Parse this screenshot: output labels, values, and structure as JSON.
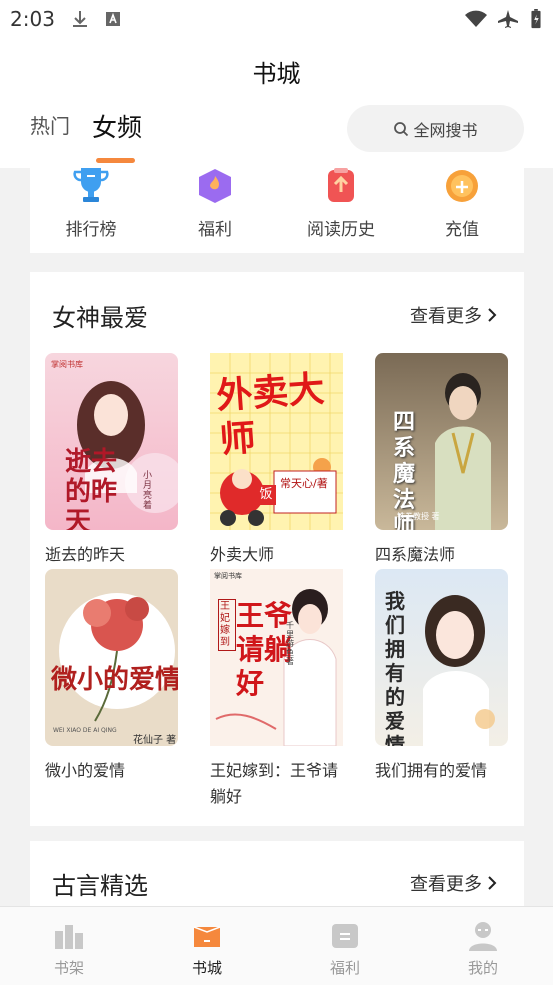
{
  "status_bar": {
    "time": "2:03"
  },
  "header": {
    "title": "书城",
    "tabs": [
      "热门",
      "女频"
    ],
    "search_label": "全网搜书"
  },
  "quick_links": [
    {
      "label": "排行榜",
      "icon": "trophy-icon"
    },
    {
      "label": "福利",
      "icon": "gift-icon"
    },
    {
      "label": "阅读历史",
      "icon": "history-icon"
    },
    {
      "label": "充值",
      "icon": "coin-icon"
    }
  ],
  "sections": [
    {
      "title": "女神最爱",
      "more": "查看更多",
      "books": [
        {
          "name": "逝去的昨天",
          "cover_title": "逝去的昨天",
          "cover_author": "小月亮着",
          "cover_badge": "掌阅书库"
        },
        {
          "name": "外卖大师",
          "cover_title": "外卖大师",
          "cover_author": "常天心/著",
          "cover_badge": "饭"
        },
        {
          "name": "四系魔法师",
          "cover_title": "四系魔法师",
          "cover_author": "铁拳教授 著"
        },
        {
          "name": "微小的爱情",
          "cover_title": "微小的爱情",
          "cover_author": "花仙子 著",
          "cover_pinyin": "WEI XIAO DE AI QING"
        },
        {
          "name": "王妃嫁到：王爷请躺好",
          "cover_title": "王爷请躺好",
          "cover_subtitle": "王妃嫁到",
          "cover_author": "千里游鱼 著",
          "cover_badge": "掌阅书库"
        },
        {
          "name": "我们拥有的爱情",
          "cover_title": "我们拥有的爱情"
        }
      ]
    },
    {
      "title": "古言精选",
      "more": "查看更多"
    }
  ],
  "tabbar": [
    {
      "label": "书架",
      "icon": "bookshelf-icon"
    },
    {
      "label": "书城",
      "icon": "bookstore-icon",
      "active": true
    },
    {
      "label": "福利",
      "icon": "welfare-icon"
    },
    {
      "label": "我的",
      "icon": "profile-icon"
    }
  ],
  "colors": {
    "accent": "#f5883d",
    "tab_inactive": "#999999",
    "page_bg": "#f2f2f2"
  }
}
